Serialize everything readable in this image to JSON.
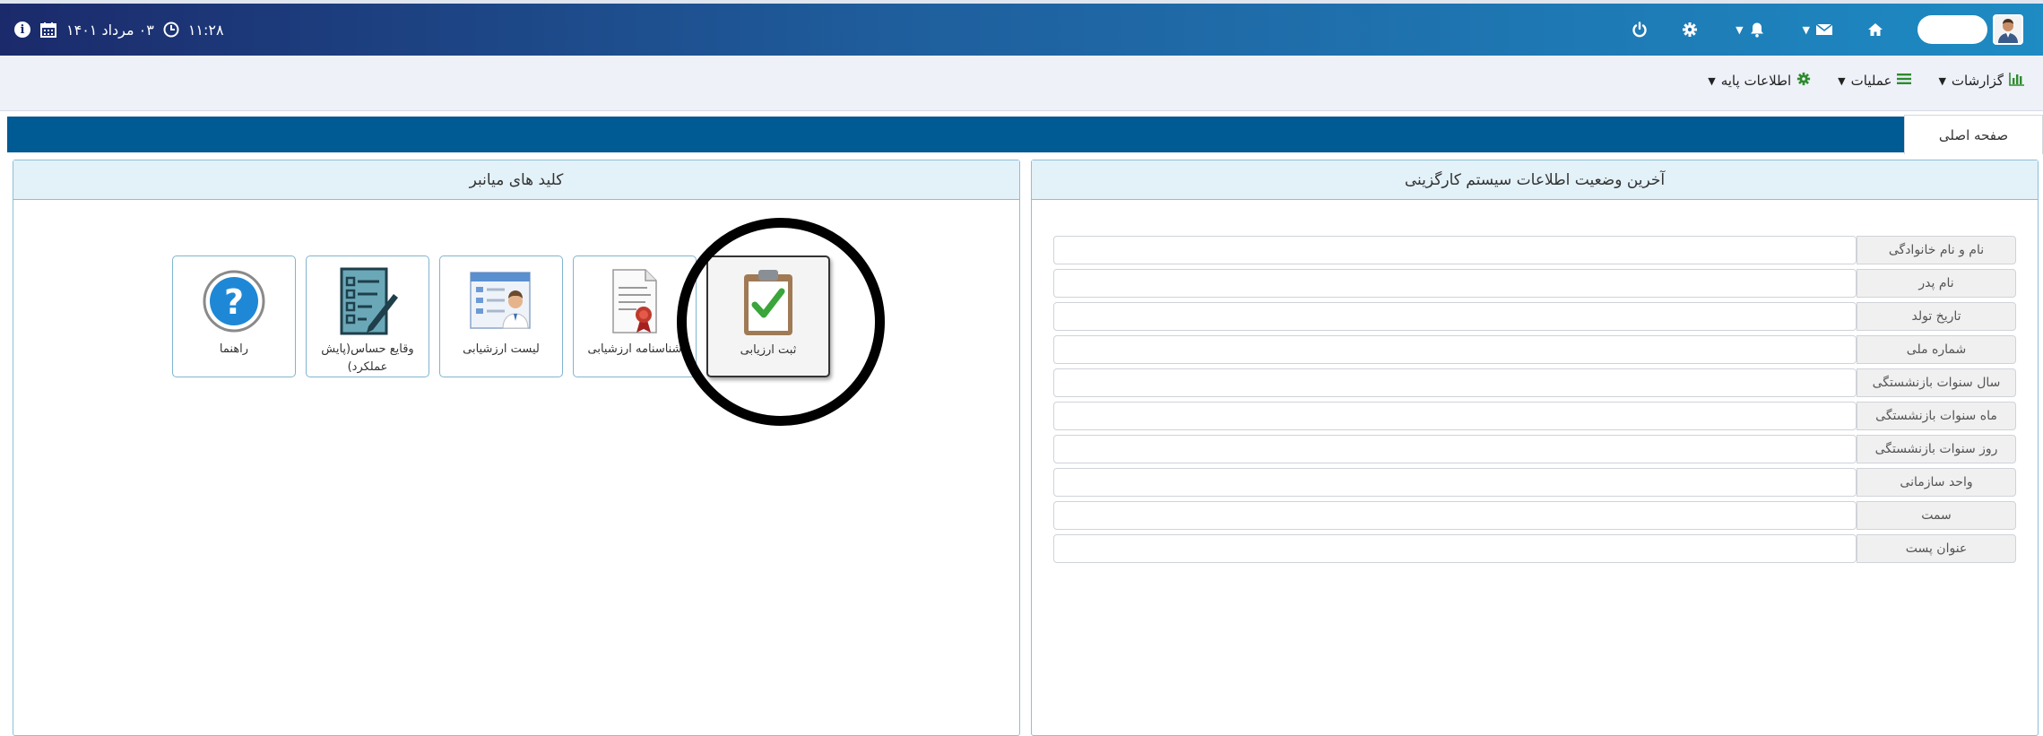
{
  "topbar": {
    "datetime": "۱۱:۲۸",
    "date_text": "۰۳ مرداد ۱۴۰۱",
    "colors": {
      "start": "#1b2a6b",
      "end": "#1e8bc3"
    },
    "icons": [
      "info-icon",
      "calendar-icon",
      "clock-icon",
      "power-icon",
      "gear-icon",
      "bell-icon",
      "envelope-icon",
      "home-icon",
      "user-avatar"
    ]
  },
  "menu": {
    "items": [
      {
        "label": "اطلاعات پایه",
        "icon": "gear-icon"
      },
      {
        "label": "عملیات",
        "icon": "bars-icon"
      },
      {
        "label": "گزارشات",
        "icon": "bar-chart-icon"
      }
    ]
  },
  "breadcrumb": {
    "tab": "صفحه اصلی",
    "bar_color": "#005a94"
  },
  "shortcuts_panel": {
    "title": "کلید های میانبر",
    "items": [
      {
        "label": "ثبت ارزیابی",
        "icon": "clipboard-check-icon",
        "active": true
      },
      {
        "label": "شناسنامه ارزشیابی",
        "icon": "certificate-icon"
      },
      {
        "label": "لیست ارزشیابی",
        "icon": "user-list-icon"
      },
      {
        "label": "وقایع حساس(پایش عملکرد)",
        "icon": "checklist-pen-icon"
      },
      {
        "label": "راهنما",
        "icon": "help-icon"
      }
    ]
  },
  "info_panel": {
    "title": "آخرین وضعیت اطلاعات سیستم کارگزینی",
    "fields": [
      {
        "label": "نام و نام خانوادگی",
        "value": ""
      },
      {
        "label": "نام پدر",
        "value": ""
      },
      {
        "label": "تاریخ تولد",
        "value": ""
      },
      {
        "label": "شماره ملی",
        "value": ""
      },
      {
        "label": "سال سنوات بازنشستگی",
        "value": ""
      },
      {
        "label": "ماه سنوات بازنشستگی",
        "value": ""
      },
      {
        "label": "روز سنوات بازنشستگی",
        "value": ""
      },
      {
        "label": "واحد سازمانی",
        "value": ""
      },
      {
        "label": "سمت",
        "value": ""
      },
      {
        "label": "عنوان پست",
        "value": ""
      }
    ]
  }
}
